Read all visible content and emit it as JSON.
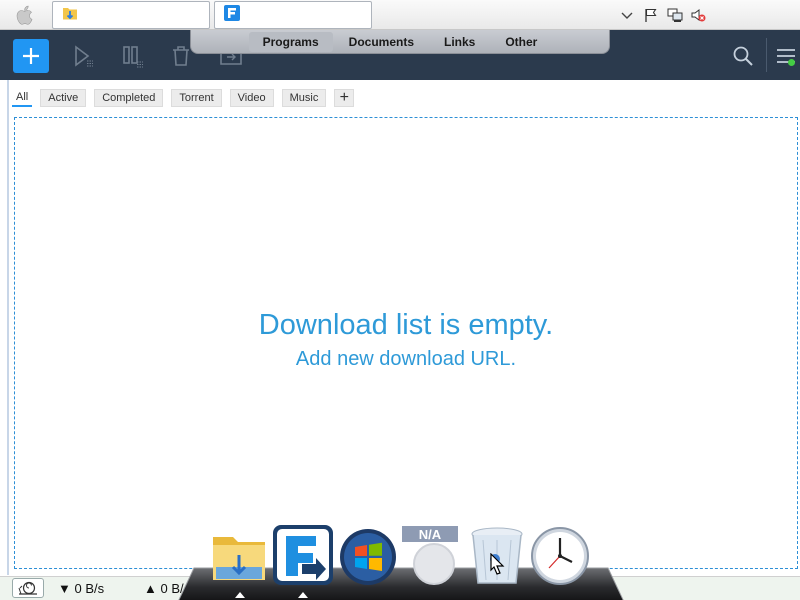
{
  "taskbar": {
    "tabs": [
      {
        "icon": "folder-icon"
      },
      {
        "icon": "free-download-manager-icon"
      }
    ],
    "tray_icons": [
      "chevron-down-icon",
      "flag-icon",
      "network-icon",
      "speaker-muted-icon"
    ]
  },
  "overlay_menu": {
    "items": [
      "Programs",
      "Documents",
      "Links",
      "Other"
    ],
    "active": "Programs"
  },
  "toolbar": {
    "buttons": [
      "add-download",
      "resume",
      "pause",
      "delete",
      "move"
    ],
    "right": [
      "search-icon",
      "hamburger-menu-icon"
    ],
    "accent": "#2196f3",
    "background": "#2b3a4d"
  },
  "filters": {
    "tabs": [
      "All",
      "Active",
      "Completed",
      "Torrent",
      "Video",
      "Music"
    ],
    "active": "All",
    "add_label": "+"
  },
  "empty_state": {
    "title": "Download list is empty.",
    "subtitle": "Add new download URL."
  },
  "status": {
    "download_speed": "▼ 0 B/s",
    "upload_speed": "▲ 0 B/"
  },
  "dock": {
    "items": [
      "folder-icon",
      "free-download-manager-icon",
      "windows-start-icon",
      "na-placeholder-icon",
      "recycle-bin-icon",
      "clock-icon"
    ],
    "na_label": "N/A"
  }
}
